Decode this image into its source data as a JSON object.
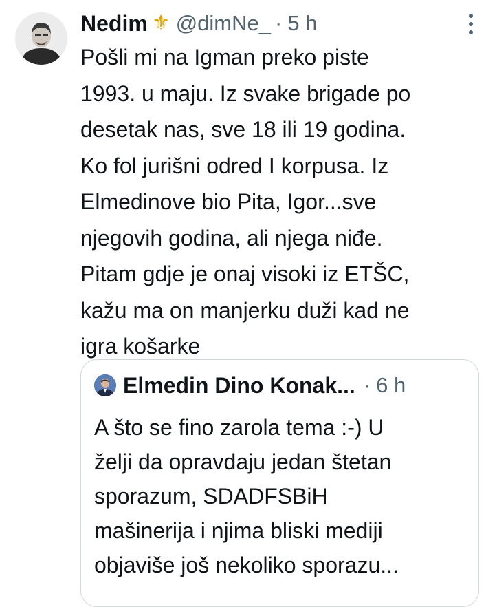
{
  "tweet": {
    "author_name": "Nedim",
    "verified_emoji": "⚜",
    "handle": "@dimNe_",
    "separator": "·",
    "time": "5 h",
    "text": "Pošli mi na Igman preko piste\n1993. u maju. Iz svake brigade po\ndesetak nas, sve 18 ili 19 godina.\nKo fol jurišni odred I korpusa.  Iz\nElmedinove bio Pita, Igor...sve\nnjegovih godina, ali njega niđe.\nPitam gdje je onaj visoki iz ETŠC,\nkažu ma on manjerku duži kad ne\nigra košarke",
    "avatar_icon": "user-avatar",
    "more_icon": "vertical-dots-icon"
  },
  "quote": {
    "author_name": "Elmedin Dino Konak...",
    "separator": "·",
    "time": "6 h",
    "text": "A što se fino zarola tema :-) U\nželji da opravdaju jedan štetan\nsporazum, SDADFSBiH\nmašinerija i njima bliski mediji\nobjaviše još nekoliko sporazu...",
    "avatar_icon": "user-avatar"
  },
  "colors": {
    "text_primary": "#0f1419",
    "text_secondary": "#536471",
    "border": "#cfd9de",
    "emoji_gold": "#e2a400"
  }
}
